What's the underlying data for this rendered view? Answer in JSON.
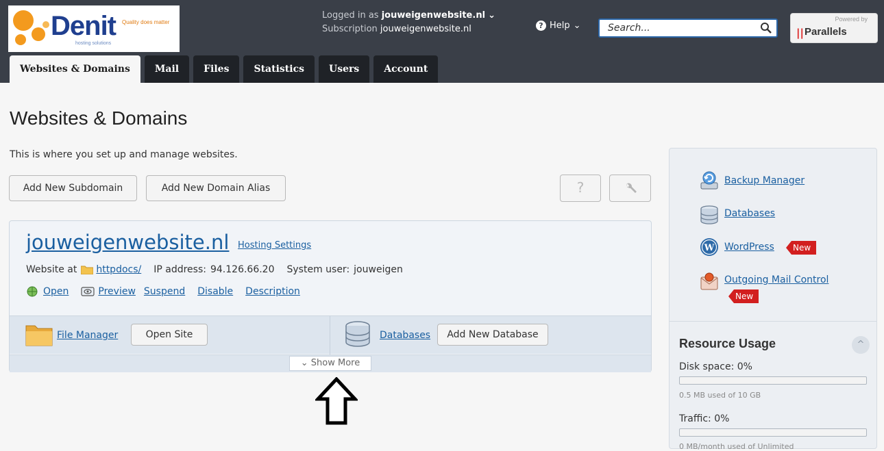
{
  "brand": {
    "logo_word": "Denit",
    "tagline": "Quality does matter",
    "subline": "hosting solutions",
    "powered_by": "Powered by",
    "powered_name": "Parallels",
    "powered_mark": "||",
    "colors": {
      "topbar": "#3a3f48",
      "logo_blue": "#1f3f8f",
      "logo_orange": "#f39a1e",
      "link": "#1a5fa0",
      "badge_red": "#d21f1f"
    }
  },
  "header": {
    "logged_in_label": "Logged in as",
    "logged_in_user": "jouweigenwebsite.nl",
    "subscription_label": "Subscription",
    "subscription_value": "jouweigenwebsite.nl",
    "help_label": "Help",
    "search_placeholder": "Search..."
  },
  "tabs": [
    {
      "label": "Websites & Domains",
      "active": true
    },
    {
      "label": "Mail"
    },
    {
      "label": "Files"
    },
    {
      "label": "Statistics"
    },
    {
      "label": "Users"
    },
    {
      "label": "Account"
    }
  ],
  "page": {
    "title": "Websites & Domains",
    "description": "This is where you set up and manage websites.",
    "add_subdomain": "Add New Subdomain",
    "add_alias": "Add New Domain Alias",
    "help_button": "?",
    "tools_button": "wrench-icon"
  },
  "domain": {
    "name": "jouweigenwebsite.nl",
    "hosting_settings": "Hosting Settings",
    "website_at_label": "Website at",
    "docroot": "httpdocs/",
    "ip_label": "IP address:",
    "ip": "94.126.66.20",
    "sysuser_label": "System user:",
    "sysuser": "jouweigen",
    "actions": {
      "open": "Open",
      "preview": "Preview",
      "suspend": "Suspend",
      "disable": "Disable",
      "description": "Description"
    },
    "file_manager": "File Manager",
    "open_site": "Open Site",
    "databases": "Databases",
    "add_database": "Add New Database",
    "show_more": "Show More"
  },
  "sidebar": {
    "links": [
      {
        "label": "Backup Manager",
        "icon": "backup-icon"
      },
      {
        "label": "Databases",
        "icon": "database-icon"
      },
      {
        "label": "WordPress",
        "icon": "wordpress-icon",
        "badge": "New"
      },
      {
        "label": "Outgoing Mail Control",
        "icon": "mail-control-icon",
        "badge": "New"
      }
    ],
    "resource_title": "Resource Usage",
    "collapse_glyph": "^",
    "disk": {
      "label": "Disk space: 0%",
      "used": "0.5 MB used of 10 GB",
      "fraction": 0.0
    },
    "traffic": {
      "label": "Traffic: 0%",
      "used": "0 MB/month used of Unlimited",
      "fraction": 0.0
    }
  }
}
